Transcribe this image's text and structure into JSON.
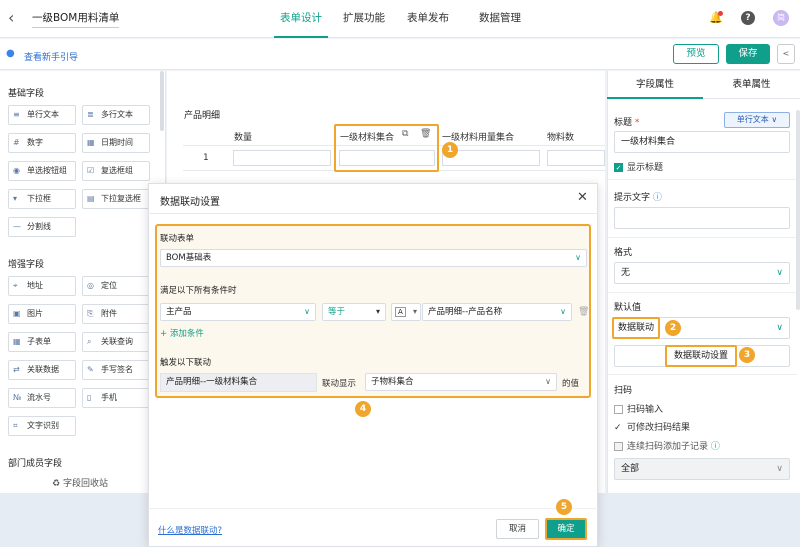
{
  "header": {
    "back_icon": "chevron-left-icon",
    "form_title": "一级BOM用料清单",
    "tabs": [
      {
        "label": "表单设计",
        "active": true
      },
      {
        "label": "扩展功能",
        "active": false
      },
      {
        "label": "表单发布",
        "active": false
      },
      {
        "label": "数据管理",
        "active": false
      }
    ],
    "avatar_text": "简",
    "accent_color": "#0f9f8a"
  },
  "guidebar": {
    "guide_label": "查看新手引导",
    "preview_label": "预览",
    "save_label": "保存"
  },
  "left_panel": {
    "basic_title": "基础字段",
    "basic_fields": [
      {
        "label": "单行文本",
        "icon": "≡"
      },
      {
        "label": "多行文本",
        "icon": "≣"
      },
      {
        "label": "数字",
        "icon": "#"
      },
      {
        "label": "日期时间",
        "icon": "▦"
      },
      {
        "label": "单选按钮组",
        "icon": "◉"
      },
      {
        "label": "复选框组",
        "icon": "☑"
      },
      {
        "label": "下拉框",
        "icon": "▾"
      },
      {
        "label": "下拉复选框",
        "icon": "▤"
      },
      {
        "label": "分割线",
        "icon": "—"
      }
    ],
    "enhanced_title": "增强字段",
    "enhanced_fields": [
      {
        "label": "地址",
        "icon": "⌖"
      },
      {
        "label": "定位",
        "icon": "◎"
      },
      {
        "label": "图片",
        "icon": "▣"
      },
      {
        "label": "附件",
        "icon": "⎘"
      },
      {
        "label": "子表单",
        "icon": "▦"
      },
      {
        "label": "关联查询",
        "icon": "⌕"
      },
      {
        "label": "关联数据",
        "icon": "⇄"
      },
      {
        "label": "手写签名",
        "icon": "✎"
      },
      {
        "label": "流水号",
        "icon": "№"
      },
      {
        "label": "手机",
        "icon": "▯"
      },
      {
        "label": "文字识别",
        "icon": "⌗"
      }
    ],
    "member_title": "部门成员字段",
    "recycle_label": "字段回收站"
  },
  "center": {
    "section_label": "产品明细",
    "columns": [
      "数量",
      "一级材料集合",
      "一级材料用量集合",
      "物料数"
    ],
    "row_number": "1",
    "callout_1": "1"
  },
  "right_panel": {
    "tabs": [
      "字段属性",
      "表单属性"
    ],
    "title_label": "标题",
    "required_mark": "*",
    "field_type": "单行文本",
    "title_value": "一级材料集合",
    "show_title_label": "显示标题",
    "hint_label": "提示文字",
    "format_label": "格式",
    "format_value": "无",
    "default_label": "默认值",
    "default_value": "数据联动",
    "linkage_settings_label": "数据联动设置",
    "scan_label": "扫码",
    "scan_input_label": "扫码输入",
    "scan_edit_label": "可修改扫码结果",
    "scan_sub_label": "连续扫码添加子记录",
    "all_value": "全部",
    "callout_2": "2",
    "callout_3": "3"
  },
  "dialog": {
    "title": "数据联动设置",
    "link_form_label": "联动表单",
    "link_form_value": "BOM基础表",
    "condition_label": "满足以下所有条件时",
    "cond_field": "主产品",
    "cond_op": "等于",
    "cond_type": "A",
    "cond_value": "产品明细--产品名称",
    "add_condition": "添加条件",
    "trigger_label": "触发以下联动",
    "trigger_field": "产品明细--一级材料集合",
    "link_show": "联动显示",
    "target_value": "子物料集合",
    "value_of": "的值",
    "help_link": "什么是数据联动?",
    "cancel_label": "取消",
    "confirm_label": "确定",
    "callout_4": "4",
    "callout_5": "5",
    "highlight_color": "#f0a52c"
  }
}
